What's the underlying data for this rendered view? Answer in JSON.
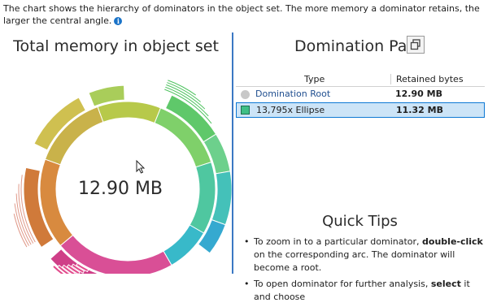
{
  "intro": {
    "text": "The chart shows the hierarchy of dominators in the object set. The more memory a dominator retains, the larger the central angle.",
    "info_icon": "info-icon"
  },
  "left_panel": {
    "title": "Total memory in object set",
    "center_value": "12.90 MB"
  },
  "right_panel": {
    "title": "Domination Path",
    "copy_icon": "copy-icon",
    "table": {
      "headers": [
        "Type",
        "Retained bytes"
      ],
      "rows": [
        {
          "name": "Domination Root",
          "retained": "12.90 MB",
          "icon": "gray-circle-icon",
          "selected": false
        },
        {
          "name": "13,795x Ellipse",
          "retained": "11.32 MB",
          "icon": "green-box-icon",
          "selected": true
        }
      ]
    }
  },
  "quick_tips": {
    "title": "Quick Tips",
    "tip1_a": "To zoom in to a particular dominator, ",
    "tip1_b": "double-click",
    "tip1_c": " on the corresponding arc. The dominator will become a root.",
    "tip2_a": "To open dominator for further analysis, ",
    "tip2_b": "select",
    "tip2_c": " it and choose"
  },
  "colors": {
    "accent": "#3b78c4",
    "inner_ring": "#6aa5e6",
    "selection": "#cce4f7"
  }
}
